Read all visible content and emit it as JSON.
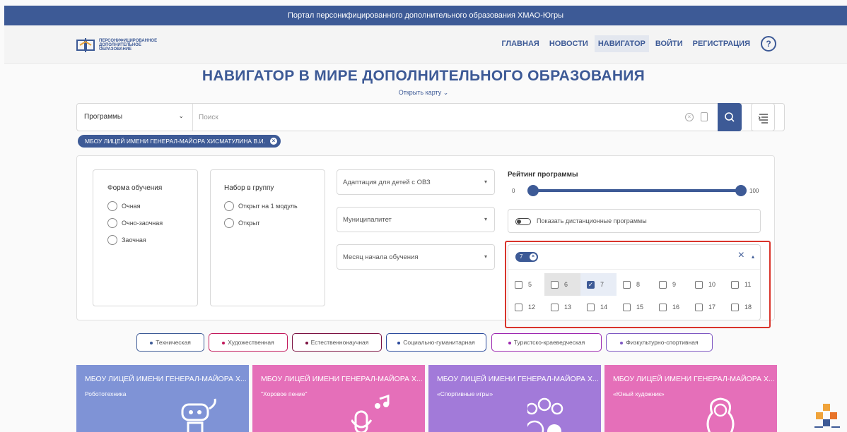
{
  "topbar": {
    "title": "Портал персонифицированного дополнительного образования ХМАО-Югры"
  },
  "logo": {
    "text": "ПЕРСОНИФИЦИРОВАННОЕ ДОПОЛНИТЕЛЬНОЕ ОБРАЗОВАНИЕ"
  },
  "menu": {
    "items": [
      "ГЛАВНАЯ",
      "НОВОСТИ",
      "НАВИГАТОР",
      "ВОЙТИ",
      "РЕГИСТРАЦИЯ"
    ],
    "active": "НАВИГАТОР",
    "help": "?"
  },
  "page": {
    "title": "НАВИГАТОР В МИРЕ ДОПОЛНИТЕЛЬНОГО ОБРАЗОВАНИЯ",
    "map_link": "Открыть карту ⌄"
  },
  "search": {
    "type": "Программы",
    "placeholder": "Поиск"
  },
  "active_filter": {
    "label": "МБОУ ЛИЦЕЙ ИМЕНИ ГЕНЕРАЛ-МАЙОРА ХИСМАТУЛИНА В.И."
  },
  "filters": {
    "form": {
      "title": "Форма обучения",
      "options": [
        "Очная",
        "Очно-заочная",
        "Заочная"
      ]
    },
    "group": {
      "title": "Набор в группу",
      "options": [
        "Открыт на 1 модуль",
        "Открыт"
      ]
    },
    "selects": {
      "ovz": "Адаптация для детей с ОВЗ",
      "municipality": "Муниципалитет",
      "month": "Месяц начала обучения"
    },
    "rating": {
      "title": "Рейтинг программы",
      "min": "0",
      "max": "100",
      "value_low": 0,
      "value_high": 100
    },
    "remote": {
      "label": "Показать дистанционные программы",
      "on": false
    },
    "age": {
      "selected_chip": "7",
      "options": [
        "5",
        "6",
        "7",
        "8",
        "9",
        "10",
        "11",
        "12",
        "13",
        "14",
        "15",
        "16",
        "17",
        "18"
      ],
      "checked": "7",
      "hovered": "6"
    }
  },
  "categories": [
    {
      "label": "Техническая",
      "color": "#3d5a96"
    },
    {
      "label": "Художественная",
      "color": "#c2185b"
    },
    {
      "label": "Естественнонаучная",
      "color": "#7b1040"
    },
    {
      "label": "Социально-гуманитарная",
      "color": "#2b4a9c"
    },
    {
      "label": "Туристско-краеведческая",
      "color": "#9c27b0"
    },
    {
      "label": "Физкультурно-спортивная",
      "color": "#7e57c2"
    }
  ],
  "cards": [
    {
      "org": "МБОУ ЛИЦЕЙ ИМЕНИ ГЕНЕРАЛ-МАЙОРА Х...",
      "name": "Робототехника",
      "color": "#7f93d6",
      "icon": "robot-icon"
    },
    {
      "org": "МБОУ ЛИЦЕЙ ИМЕНИ ГЕНЕРАЛ-МАЙОРА Х...",
      "name": "\"Хоровое пение\"",
      "color": "#e56fb9",
      "icon": "microphone-icon"
    },
    {
      "org": "МБОУ ЛИЦЕЙ ИМЕНИ ГЕНЕРАЛ-МАЙОРА Х...",
      "name": "«Спортивные игры»",
      "color": "#a27ad9",
      "icon": "sports-balls-icon"
    },
    {
      "org": "МБОУ ЛИЦЕЙ ИМЕНИ ГЕНЕРАЛ-МАЙОРА Х...",
      "name": "«Юный художник»",
      "color": "#e56fb9",
      "icon": "matryoshka-icon"
    }
  ]
}
